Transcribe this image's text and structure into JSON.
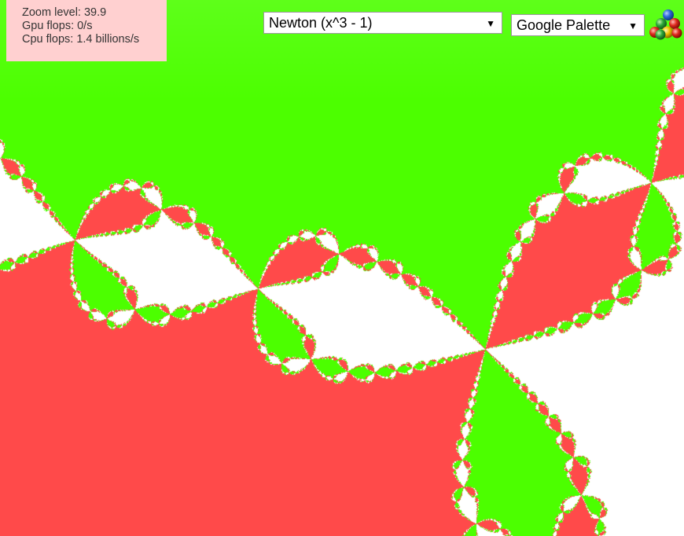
{
  "stats": {
    "zoom_label": "Zoom level: 39.9",
    "gpu_label": "Gpu flops: 0/s",
    "cpu_label": "Cpu flops: 1.4 billions/s"
  },
  "fractal_select": {
    "selected": "Newton (x^3 - 1)"
  },
  "palette_select": {
    "selected": "Google Palette"
  },
  "palette_icon": {
    "name": "color-balls-icon"
  },
  "colors": {
    "root_1": "#ff4a4a",
    "root_2": "#4cff00",
    "root_3": "#ffffff",
    "stats_background": "#ffd0d0"
  }
}
